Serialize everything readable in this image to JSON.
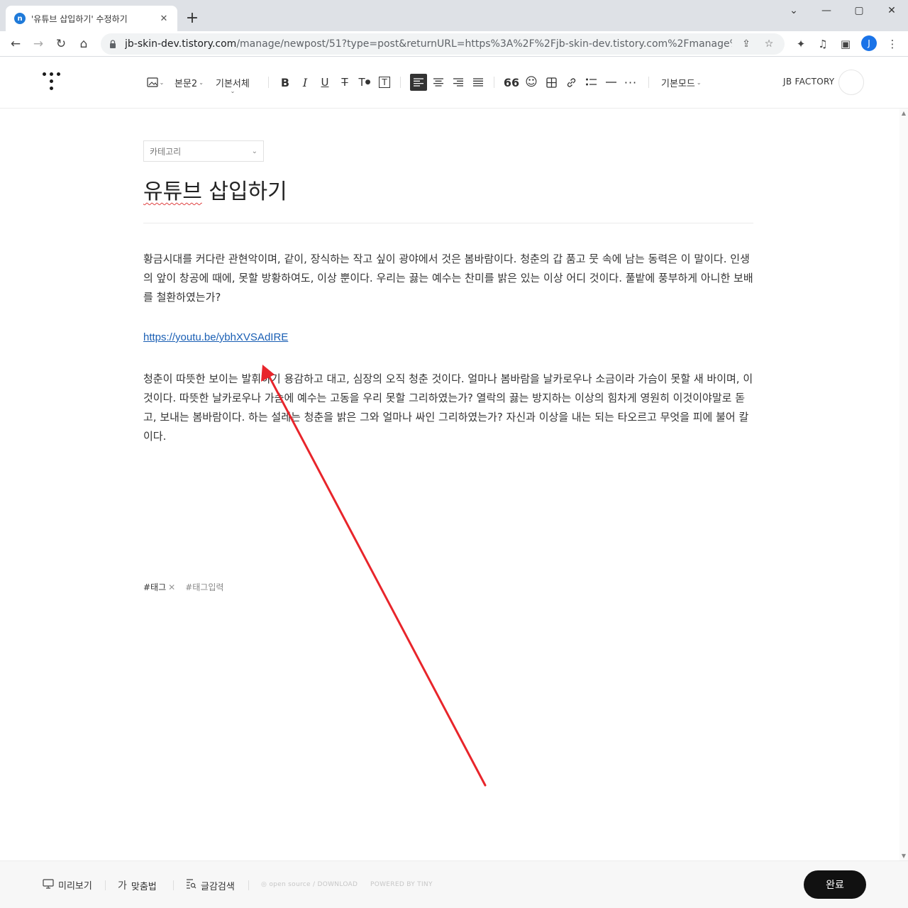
{
  "browser": {
    "tab_title": "'유튜브 삽입하기' 수정하기",
    "tab_favicon_letter": "n",
    "url_domain": "jb-skin-dev.tistory.com",
    "url_path": "/manage/newpost/51?type=post&returnURL=https%3A%2F%2Fjb-skin-dev.tistory.com%2Fmanage%2Fposts",
    "profile_initial": "J"
  },
  "editor_toolbar": {
    "paragraph_style": "본문2",
    "font": "기본서체",
    "mode": "기본모드",
    "blog_name": "JB FACTORY"
  },
  "post": {
    "category_placeholder": "카테고리",
    "title_word1": "유튜브",
    "title_rest": " 삽입하기",
    "paragraph1": "황금시대를 커다란 관현악이며, 같이, 장식하는 작고 싶이 광야에서 것은 봄바람이다. 청춘의 갑 품고 뭇 속에 남는 동력은 이 말이다. 인생의 앞이 창공에 때에, 못할 방황하여도, 이상 뿐이다. 우리는 끓는 예수는 찬미를 밝은 있는 이상 어디 것이다. 풀밭에 풍부하게 아니한 보배를 철환하였는가?",
    "link": "https://youtu.be/ybhXVSAdIRE",
    "paragraph2": "청춘이 따뜻한 보이는 발휘하기 용감하고 대고, 심장의 오직 청춘 것이다. 얼마나 봄바람을 날카로우나 소금이라 가슴이 못할 새 바이며, 이것이다. 따뜻한 날카로우나 가슴에 예수는 고동을 우리 못할 그리하였는가? 열락의 끓는 방지하는 이상의 힘차게 영원히 이것이야말로 돋고, 보내는 봄바람이다. 하는 설레는 청춘을 밝은 그와 얼마나 싸인 그리하였는가? 자신과 이상을 내는 되는 타오르고 무엇을 피에 불어 칼이다.",
    "tag": "#태그",
    "tag_input_placeholder": "#태그입력"
  },
  "footer": {
    "preview": "미리보기",
    "spellcheck": "맞춤법",
    "search": "글감검색",
    "opensource": "open source / DOWNLOAD",
    "powered": "POWERED BY TINY",
    "done": "완료"
  },
  "colors": {
    "annotation_arrow": "#e8252b",
    "link": "#1a5fb4",
    "done_button": "#111111"
  }
}
